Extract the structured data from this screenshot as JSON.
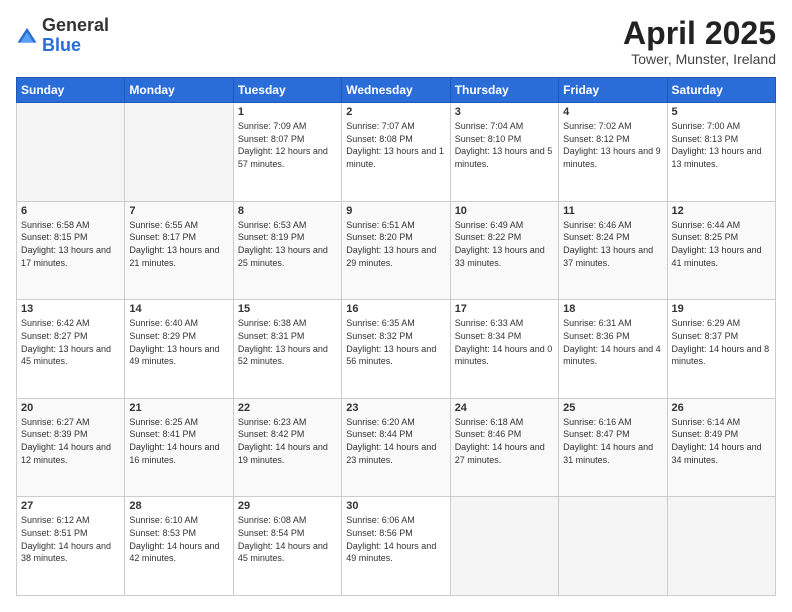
{
  "logo": {
    "general": "General",
    "blue": "Blue"
  },
  "title": {
    "month": "April 2025",
    "location": "Tower, Munster, Ireland"
  },
  "weekdays": [
    "Sunday",
    "Monday",
    "Tuesday",
    "Wednesday",
    "Thursday",
    "Friday",
    "Saturday"
  ],
  "weeks": [
    [
      {
        "day": "",
        "sunrise": "",
        "sunset": "",
        "daylight": ""
      },
      {
        "day": "",
        "sunrise": "",
        "sunset": "",
        "daylight": ""
      },
      {
        "day": "1",
        "sunrise": "Sunrise: 7:09 AM",
        "sunset": "Sunset: 8:07 PM",
        "daylight": "Daylight: 12 hours and 57 minutes."
      },
      {
        "day": "2",
        "sunrise": "Sunrise: 7:07 AM",
        "sunset": "Sunset: 8:08 PM",
        "daylight": "Daylight: 13 hours and 1 minute."
      },
      {
        "day": "3",
        "sunrise": "Sunrise: 7:04 AM",
        "sunset": "Sunset: 8:10 PM",
        "daylight": "Daylight: 13 hours and 5 minutes."
      },
      {
        "day": "4",
        "sunrise": "Sunrise: 7:02 AM",
        "sunset": "Sunset: 8:12 PM",
        "daylight": "Daylight: 13 hours and 9 minutes."
      },
      {
        "day": "5",
        "sunrise": "Sunrise: 7:00 AM",
        "sunset": "Sunset: 8:13 PM",
        "daylight": "Daylight: 13 hours and 13 minutes."
      }
    ],
    [
      {
        "day": "6",
        "sunrise": "Sunrise: 6:58 AM",
        "sunset": "Sunset: 8:15 PM",
        "daylight": "Daylight: 13 hours and 17 minutes."
      },
      {
        "day": "7",
        "sunrise": "Sunrise: 6:55 AM",
        "sunset": "Sunset: 8:17 PM",
        "daylight": "Daylight: 13 hours and 21 minutes."
      },
      {
        "day": "8",
        "sunrise": "Sunrise: 6:53 AM",
        "sunset": "Sunset: 8:19 PM",
        "daylight": "Daylight: 13 hours and 25 minutes."
      },
      {
        "day": "9",
        "sunrise": "Sunrise: 6:51 AM",
        "sunset": "Sunset: 8:20 PM",
        "daylight": "Daylight: 13 hours and 29 minutes."
      },
      {
        "day": "10",
        "sunrise": "Sunrise: 6:49 AM",
        "sunset": "Sunset: 8:22 PM",
        "daylight": "Daylight: 13 hours and 33 minutes."
      },
      {
        "day": "11",
        "sunrise": "Sunrise: 6:46 AM",
        "sunset": "Sunset: 8:24 PM",
        "daylight": "Daylight: 13 hours and 37 minutes."
      },
      {
        "day": "12",
        "sunrise": "Sunrise: 6:44 AM",
        "sunset": "Sunset: 8:25 PM",
        "daylight": "Daylight: 13 hours and 41 minutes."
      }
    ],
    [
      {
        "day": "13",
        "sunrise": "Sunrise: 6:42 AM",
        "sunset": "Sunset: 8:27 PM",
        "daylight": "Daylight: 13 hours and 45 minutes."
      },
      {
        "day": "14",
        "sunrise": "Sunrise: 6:40 AM",
        "sunset": "Sunset: 8:29 PM",
        "daylight": "Daylight: 13 hours and 49 minutes."
      },
      {
        "day": "15",
        "sunrise": "Sunrise: 6:38 AM",
        "sunset": "Sunset: 8:31 PM",
        "daylight": "Daylight: 13 hours and 52 minutes."
      },
      {
        "day": "16",
        "sunrise": "Sunrise: 6:35 AM",
        "sunset": "Sunset: 8:32 PM",
        "daylight": "Daylight: 13 hours and 56 minutes."
      },
      {
        "day": "17",
        "sunrise": "Sunrise: 6:33 AM",
        "sunset": "Sunset: 8:34 PM",
        "daylight": "Daylight: 14 hours and 0 minutes."
      },
      {
        "day": "18",
        "sunrise": "Sunrise: 6:31 AM",
        "sunset": "Sunset: 8:36 PM",
        "daylight": "Daylight: 14 hours and 4 minutes."
      },
      {
        "day": "19",
        "sunrise": "Sunrise: 6:29 AM",
        "sunset": "Sunset: 8:37 PM",
        "daylight": "Daylight: 14 hours and 8 minutes."
      }
    ],
    [
      {
        "day": "20",
        "sunrise": "Sunrise: 6:27 AM",
        "sunset": "Sunset: 8:39 PM",
        "daylight": "Daylight: 14 hours and 12 minutes."
      },
      {
        "day": "21",
        "sunrise": "Sunrise: 6:25 AM",
        "sunset": "Sunset: 8:41 PM",
        "daylight": "Daylight: 14 hours and 16 minutes."
      },
      {
        "day": "22",
        "sunrise": "Sunrise: 6:23 AM",
        "sunset": "Sunset: 8:42 PM",
        "daylight": "Daylight: 14 hours and 19 minutes."
      },
      {
        "day": "23",
        "sunrise": "Sunrise: 6:20 AM",
        "sunset": "Sunset: 8:44 PM",
        "daylight": "Daylight: 14 hours and 23 minutes."
      },
      {
        "day": "24",
        "sunrise": "Sunrise: 6:18 AM",
        "sunset": "Sunset: 8:46 PM",
        "daylight": "Daylight: 14 hours and 27 minutes."
      },
      {
        "day": "25",
        "sunrise": "Sunrise: 6:16 AM",
        "sunset": "Sunset: 8:47 PM",
        "daylight": "Daylight: 14 hours and 31 minutes."
      },
      {
        "day": "26",
        "sunrise": "Sunrise: 6:14 AM",
        "sunset": "Sunset: 8:49 PM",
        "daylight": "Daylight: 14 hours and 34 minutes."
      }
    ],
    [
      {
        "day": "27",
        "sunrise": "Sunrise: 6:12 AM",
        "sunset": "Sunset: 8:51 PM",
        "daylight": "Daylight: 14 hours and 38 minutes."
      },
      {
        "day": "28",
        "sunrise": "Sunrise: 6:10 AM",
        "sunset": "Sunset: 8:53 PM",
        "daylight": "Daylight: 14 hours and 42 minutes."
      },
      {
        "day": "29",
        "sunrise": "Sunrise: 6:08 AM",
        "sunset": "Sunset: 8:54 PM",
        "daylight": "Daylight: 14 hours and 45 minutes."
      },
      {
        "day": "30",
        "sunrise": "Sunrise: 6:06 AM",
        "sunset": "Sunset: 8:56 PM",
        "daylight": "Daylight: 14 hours and 49 minutes."
      },
      {
        "day": "",
        "sunrise": "",
        "sunset": "",
        "daylight": ""
      },
      {
        "day": "",
        "sunrise": "",
        "sunset": "",
        "daylight": ""
      },
      {
        "day": "",
        "sunrise": "",
        "sunset": "",
        "daylight": ""
      }
    ]
  ]
}
